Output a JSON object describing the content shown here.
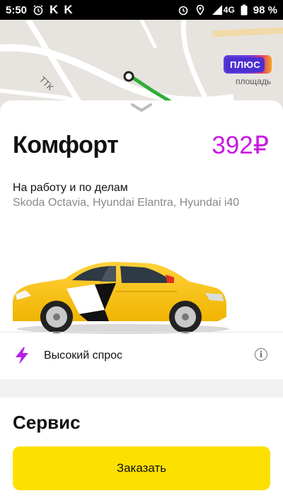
{
  "status_bar": {
    "time": "5:50",
    "app_letter_1": "K",
    "app_letter_2": "K",
    "network": "4G",
    "battery": "98 %"
  },
  "map": {
    "plus_badge": "ПЛЮС",
    "place_label": "площадь",
    "road_label": "ТТК",
    "carousel_pages": 11,
    "carousel_active_index": 1
  },
  "tariff": {
    "name": "Комфорт",
    "price": "392₽",
    "description": "На работу и по делам",
    "models": "Skoda Octavia, Hyundai Elantra, Hyundai i40"
  },
  "demand": {
    "label": "Высокий спрос",
    "icon": "lightning-bolt-icon"
  },
  "service": {
    "title": "Сервис"
  },
  "order": {
    "button_label": "Заказать"
  },
  "colors": {
    "accent_yellow": "#fce000",
    "price_magenta": "#c81ae0",
    "bolt_purple": "#b51ee6"
  }
}
